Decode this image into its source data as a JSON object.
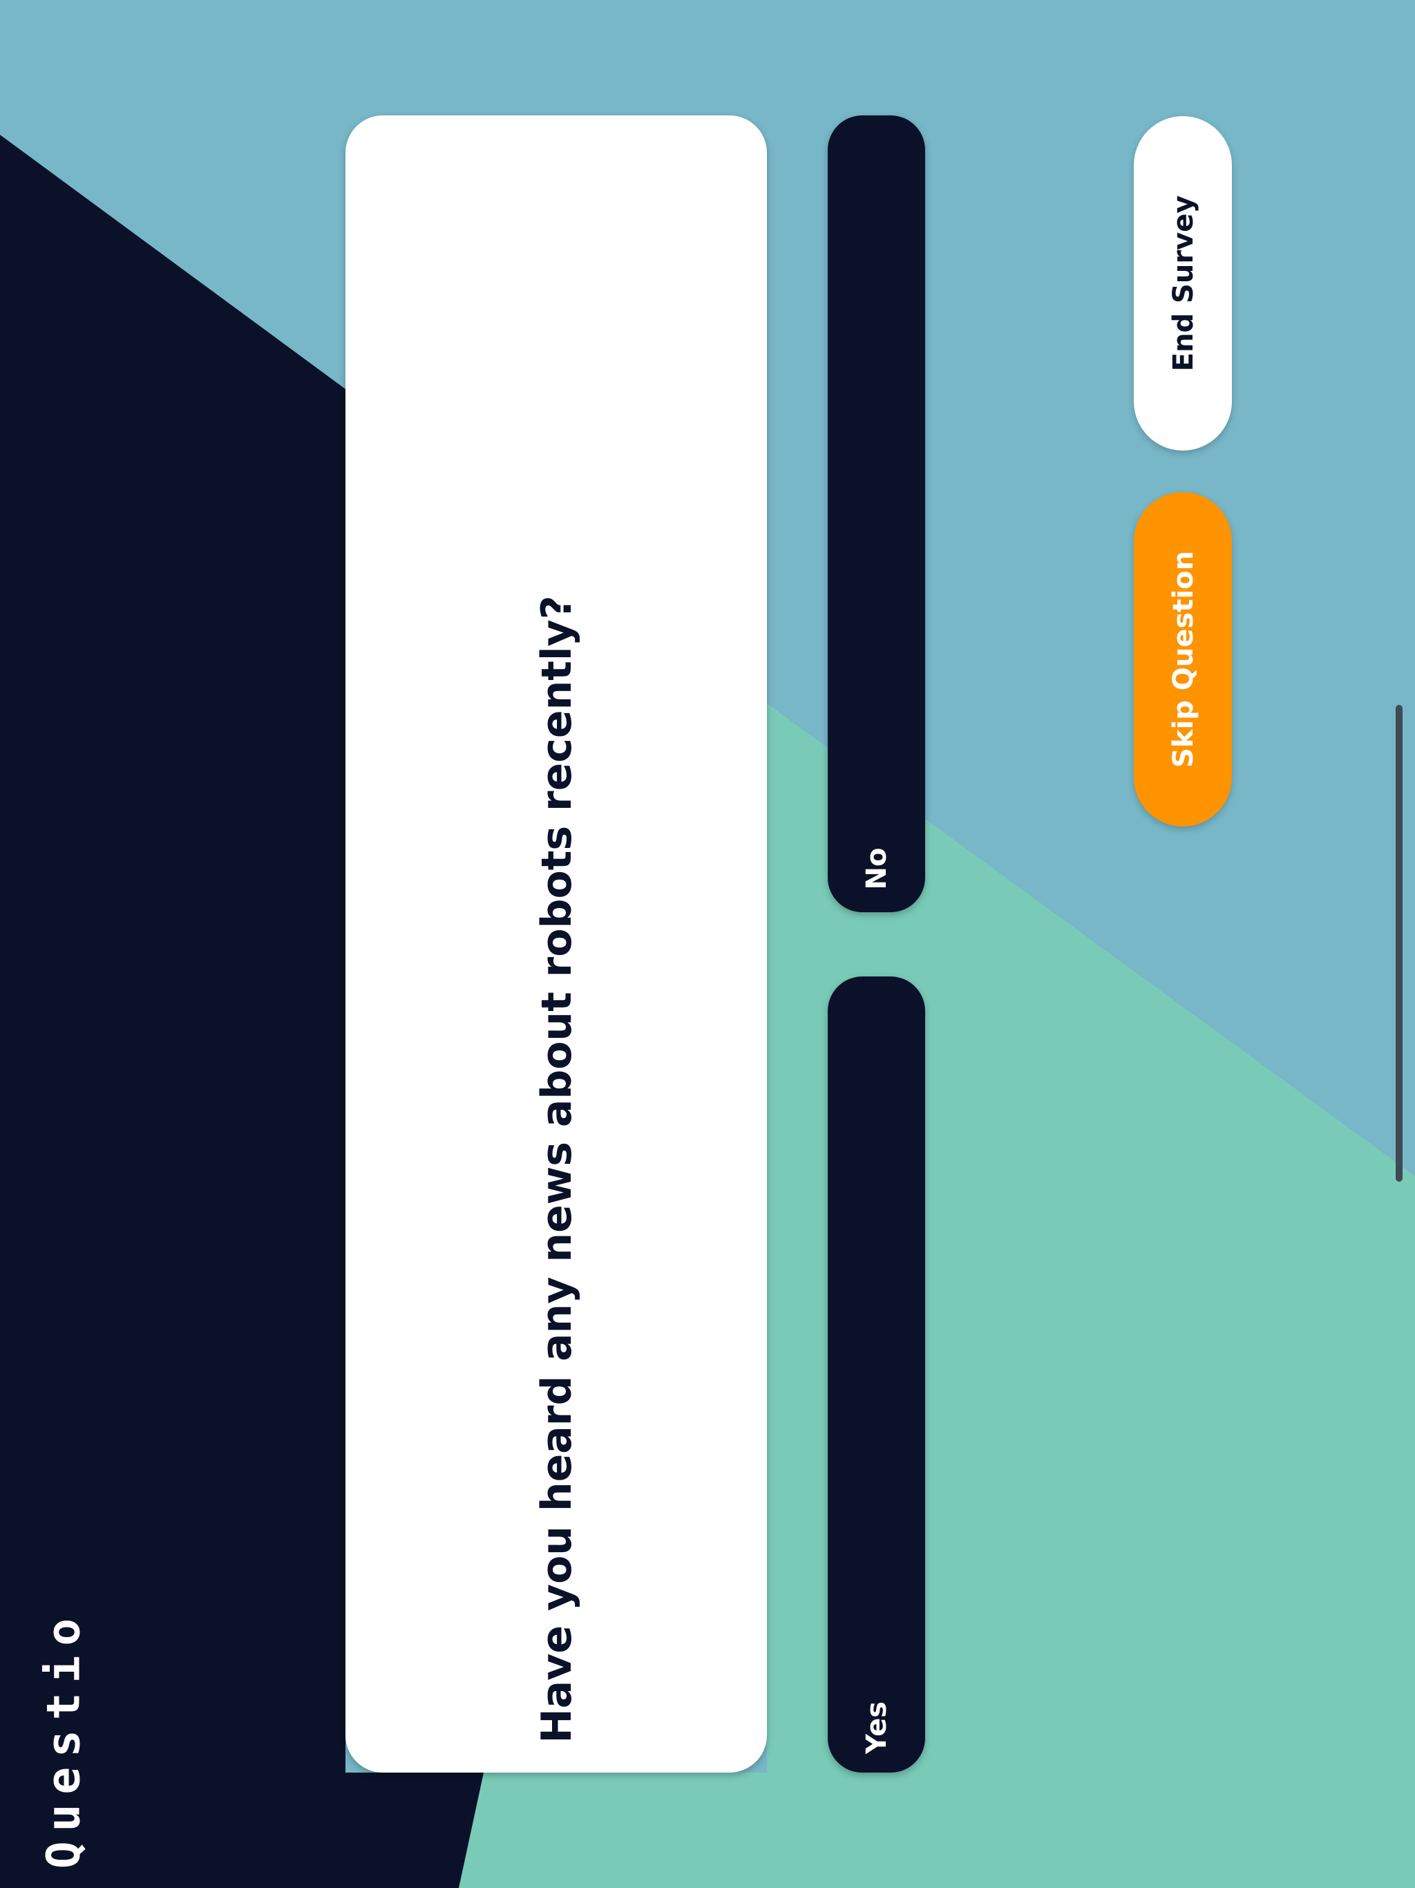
{
  "brand": {
    "logo_text": "Questio"
  },
  "question": {
    "text": "Have you heard any news about robots recently?"
  },
  "answers": [
    {
      "label": "No"
    },
    {
      "label": "Yes"
    }
  ],
  "actions": {
    "end_survey_label": "End Survey",
    "skip_question_label": "Skip Question"
  },
  "colors": {
    "background_blue": "#77b7c8",
    "background_teal": "#79cbb8",
    "navy": "#0b1128",
    "accent_orange": "#ff9300",
    "white": "#ffffff"
  }
}
